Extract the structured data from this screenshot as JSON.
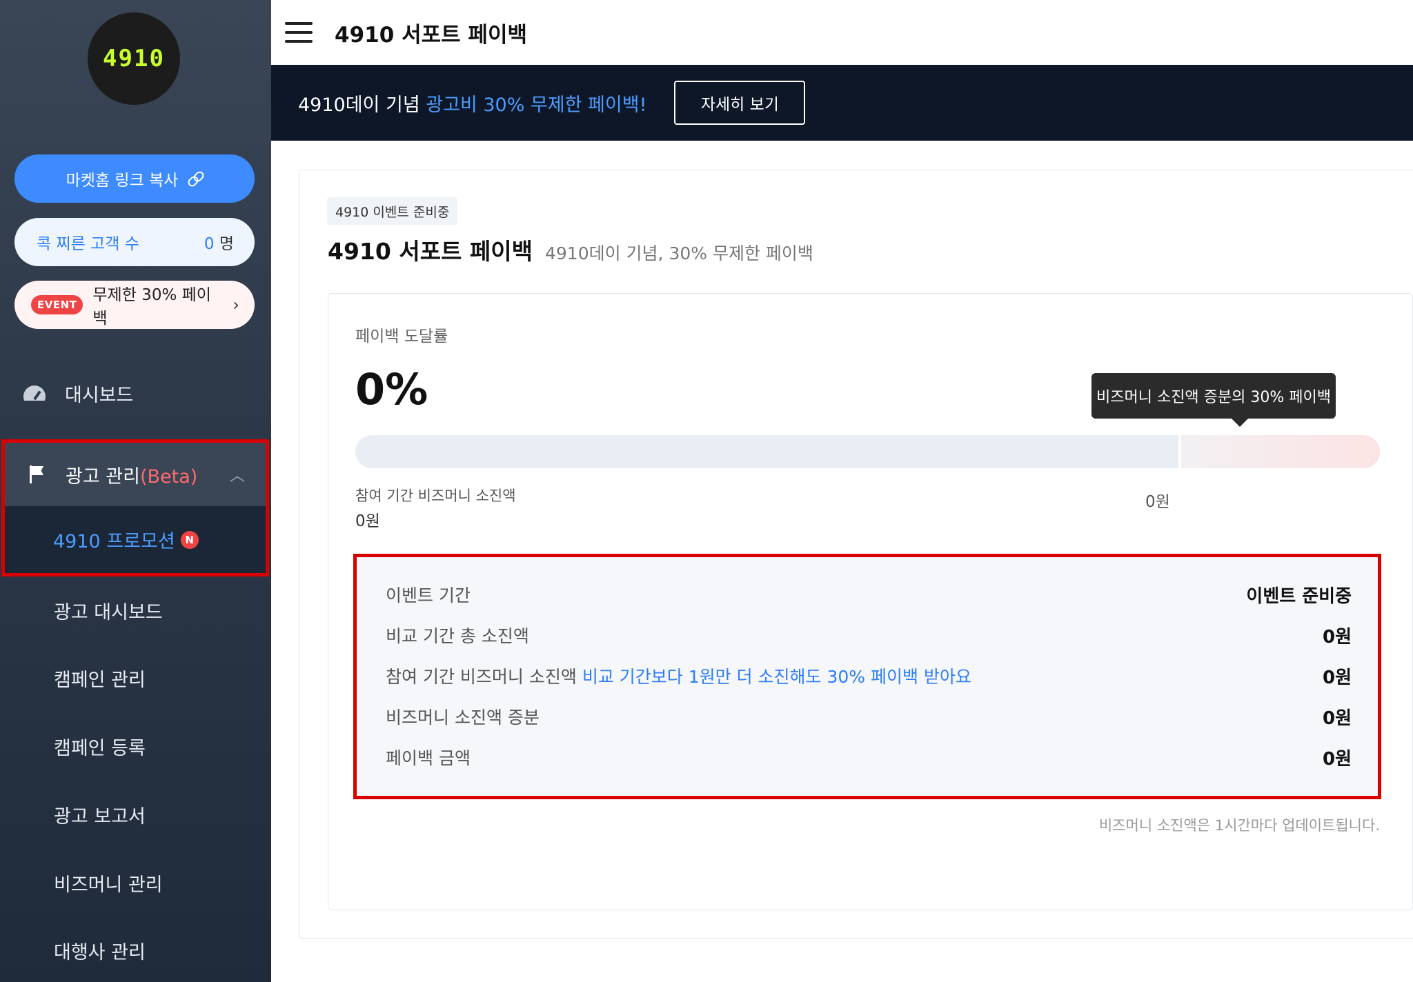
{
  "sidebar": {
    "logo_text": "4910",
    "link_copy": {
      "label": "마켓홈 링크 복사"
    },
    "poke": {
      "label": "콕 찌른 고객 수",
      "count": "0",
      "unit": "명"
    },
    "event_pill": {
      "badge": "EVENT",
      "label": "무제한 30% 페이백"
    },
    "dashboard": {
      "label": "대시보드"
    },
    "ad_group": {
      "label": "광고 관리",
      "beta": "(Beta)",
      "sub_label": "4910 프로모션",
      "new_badge": "N"
    },
    "items": [
      "광고 대시보드",
      "캠페인 관리",
      "캠페인 등록",
      "광고 보고서",
      "비즈머니 관리",
      "대행사 관리"
    ]
  },
  "topbar": {
    "title": "4910 서포트 페이백"
  },
  "banner": {
    "text": "4910데이 기념 ",
    "highlight": "광고비 30% 무제한 페이백!",
    "button": "자세히 보기"
  },
  "main": {
    "status_chip": "4910 이벤트 준비중",
    "title": "4910 서포트 페이백",
    "subtitle": "4910데이 기념, 30% 무제한 페이백",
    "rate_label": "페이백 도달률",
    "rate_value": "0%",
    "progress": 0,
    "tooltip": "비즈머니 소진액 증분의 30% 페이백",
    "spend_label": "참여 기간 비즈머니 소진액",
    "spend_value": "0원",
    "target_value": "0원",
    "details": [
      {
        "key": "이벤트 기간",
        "value": "이벤트 준비중"
      },
      {
        "key": "비교 기간 총 소진액",
        "value": "0원"
      },
      {
        "key": "참여 기간 비즈머니 소진액",
        "note": "비교 기간보다 1원만 더 소진해도 30% 페이백 받아요",
        "value": "0원"
      },
      {
        "key": "비즈머니 소진액 증분",
        "value": "0원"
      },
      {
        "key": "페이백 금액",
        "value": "0원"
      }
    ],
    "footnote": "비즈머니 소진액은 1시간마다 업데이트됩니다."
  },
  "colors": {
    "accent": "#3d8bff",
    "highlight_border": "#d90000",
    "banner_bg": "#0d1728",
    "sidebar_bg": "#2c3848"
  }
}
